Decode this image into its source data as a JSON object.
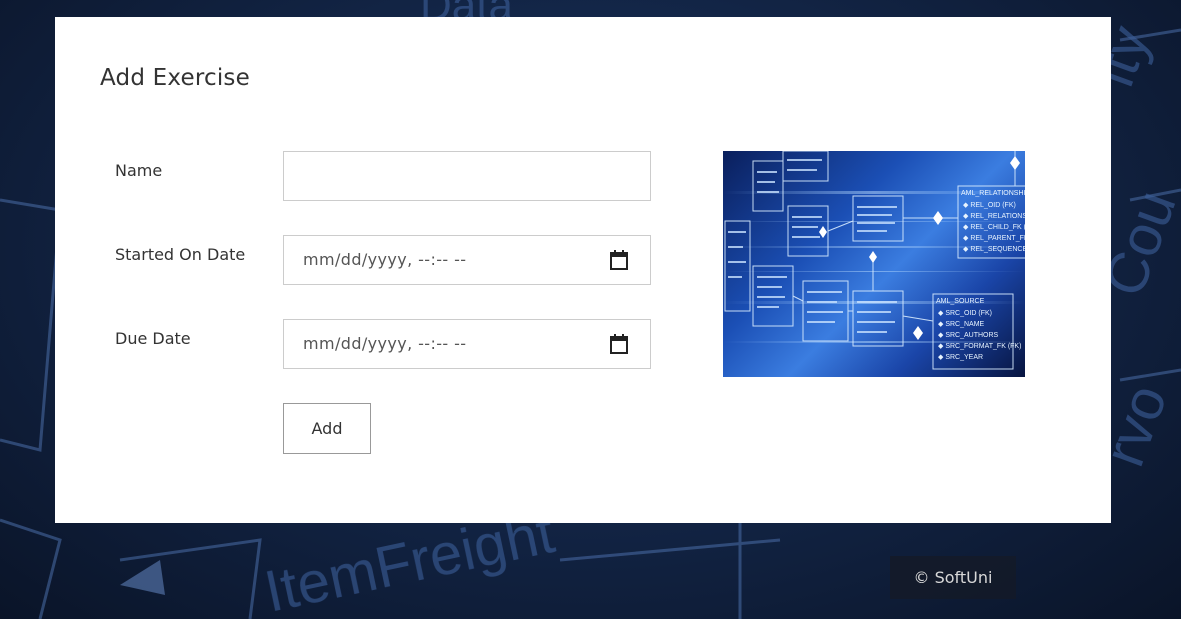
{
  "page": {
    "title": "Add Exercise"
  },
  "form": {
    "name_label": "Name",
    "name_value": "",
    "started_label": "Started On Date",
    "started_placeholder": "mm/dd/yyyy, --:-- --",
    "due_label": "Due Date",
    "due_placeholder": "mm/dd/yyyy, --:-- --",
    "add_label": "Add"
  },
  "image": {
    "icon": "database-schema-image",
    "schema_labels": [
      "AML_RELATIONSHIP",
      "REL_OID (FK)",
      "REL_RELATIONSHIP",
      "REL_CHILD_FK (FK)",
      "REL_PARENT_FK (FK)",
      "REL_SEQUENCE",
      "AML_SOURCE",
      "SRC_OID (FK)",
      "SRC_NAME",
      "SRC_AUTHORS",
      "SRC_FORMAT_FK (FK)",
      "SRC_YEAR"
    ]
  },
  "footer": {
    "copyright": "© SoftUni"
  },
  "colors": {
    "card_bg": "#ffffff",
    "text": "#333333",
    "input_border": "#cccccc",
    "button_border": "#999999",
    "page_bg": "#132648"
  }
}
